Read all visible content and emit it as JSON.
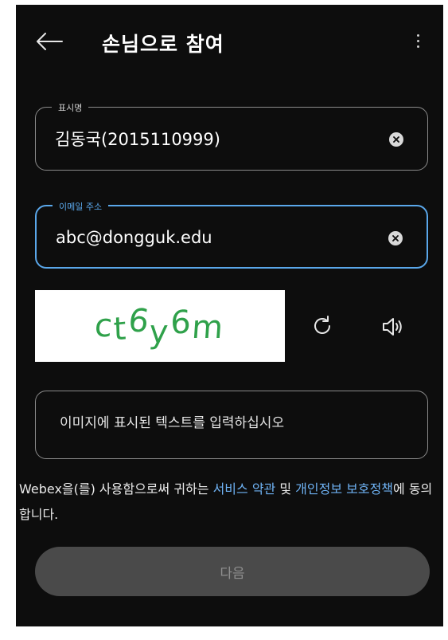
{
  "header": {
    "title": "손님으로 참여",
    "back_icon": "arrow-left-icon",
    "more_icon": "more-vertical-icon"
  },
  "display_name_field": {
    "label": "표시명",
    "value": "김동국(2015110999)"
  },
  "email_field": {
    "label": "이메일 주소",
    "value": "abc@dongguk.edu"
  },
  "captcha": {
    "image_text": "ct6y6m",
    "refresh_icon": "refresh-icon",
    "audio_icon": "speaker-icon",
    "input_placeholder": "이미지에 표시된 텍스트를 입력하십시오"
  },
  "terms": {
    "prefix": "Webex을(를) 사용함으로써 귀하는 ",
    "link_service": "서비스 약관",
    "middle": " 및 ",
    "link_privacy": "개인정보 보호정책",
    "suffix": "에 동의합니다."
  },
  "next_button": {
    "label": "다음"
  },
  "colors": {
    "background": "#0d0d0d",
    "accent": "#5aa7ea",
    "link": "#6fb3f5",
    "captcha_green": "#2fa14a",
    "disabled_button": "#4a4a4a"
  }
}
